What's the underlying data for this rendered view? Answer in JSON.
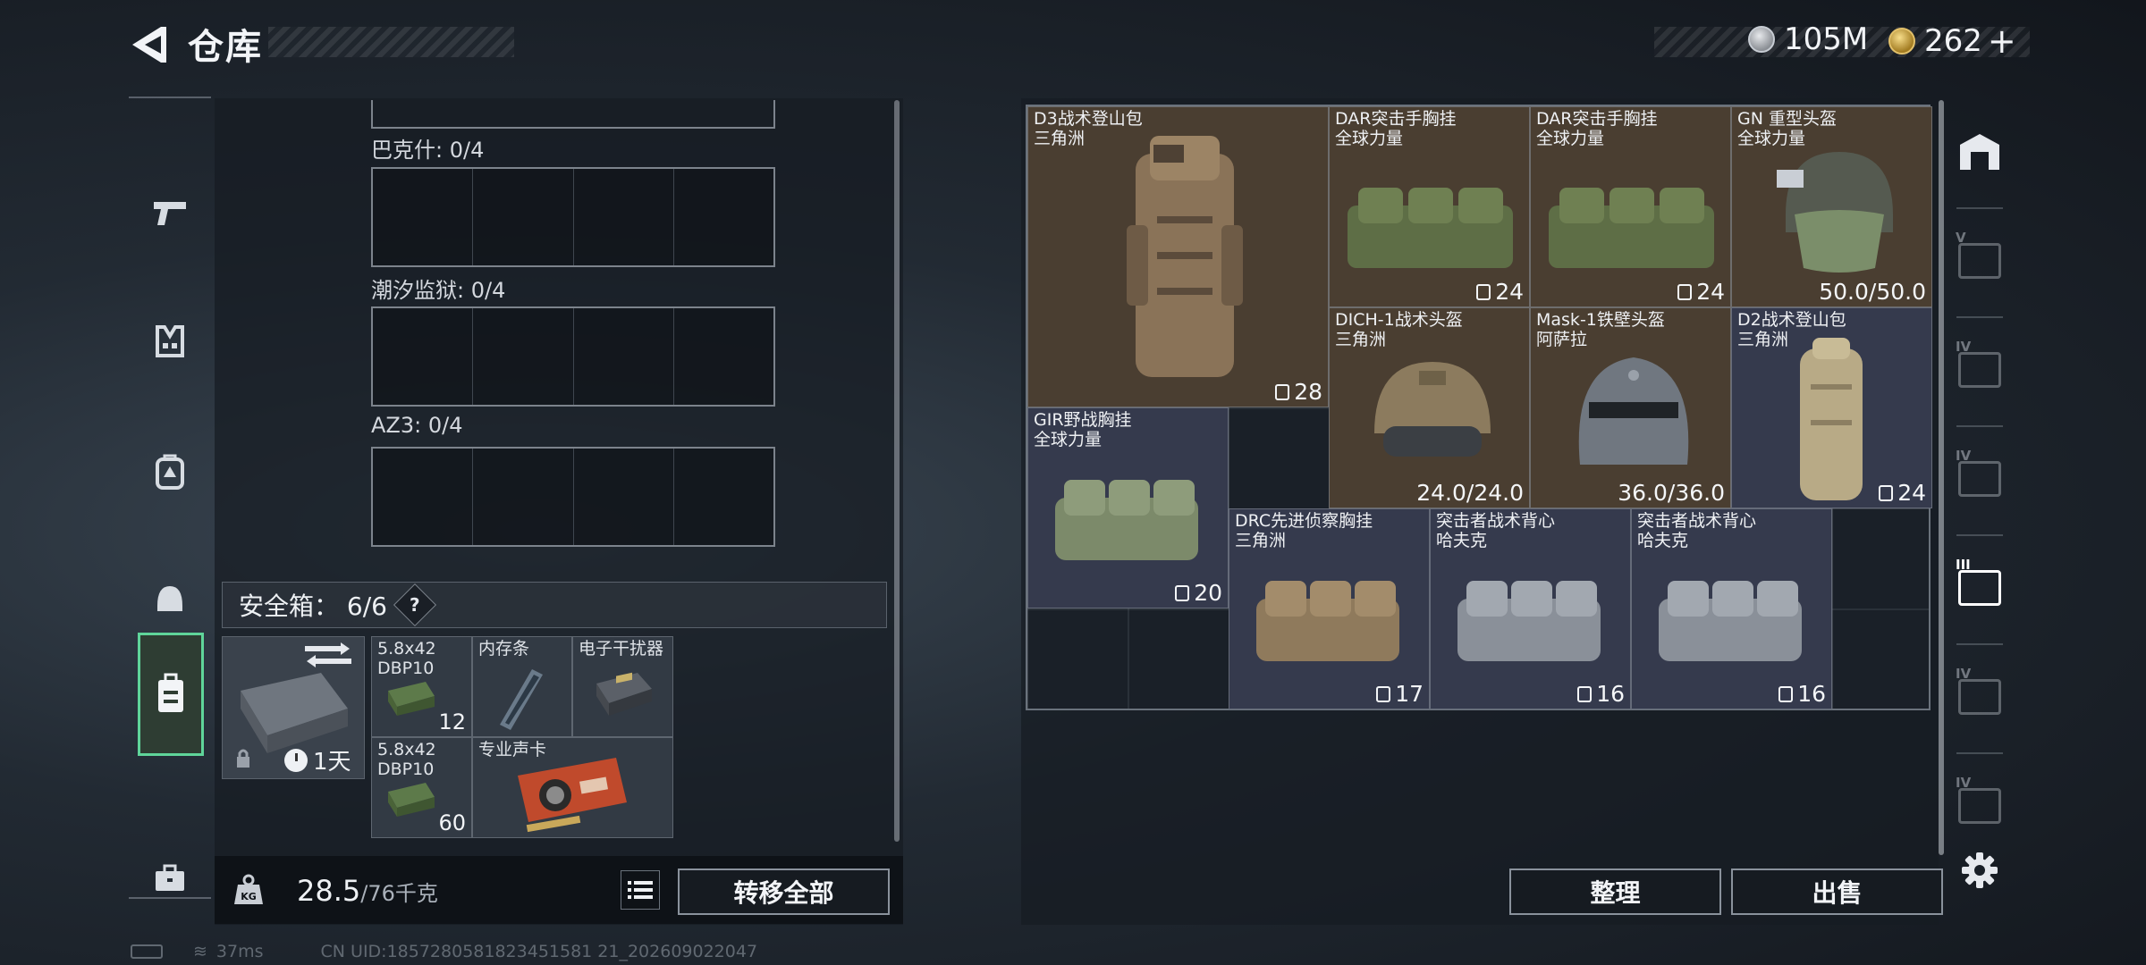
{
  "header": {
    "title": "仓库",
    "currency_silver": "105M",
    "currency_gold": "262"
  },
  "left_tabs": [
    {
      "icon": "pistol-icon"
    },
    {
      "icon": "vest-icon"
    },
    {
      "icon": "backpack-icon"
    },
    {
      "icon": "helmet-icon"
    },
    {
      "icon": "safe-case-icon",
      "active": true
    },
    {
      "icon": "briefcase-icon"
    }
  ],
  "slots": [
    {
      "label": "巴克什: 0/4"
    },
    {
      "label": "潮汐监狱: 0/4"
    },
    {
      "label": "AZ3: 0/4"
    }
  ],
  "safe": {
    "label": "安全箱： 6/6",
    "help": "?",
    "time": "1天",
    "items": [
      {
        "name_line1": "5.8x42",
        "name_line2": "DBP10",
        "count": "12"
      },
      {
        "name_line1": "内存条",
        "name_line2": "",
        "count": ""
      },
      {
        "name_line1": "电子干扰器",
        "name_line2": "",
        "count": ""
      },
      {
        "name_line1": "5.8x42",
        "name_line2": "DBP10",
        "count": "60"
      },
      {
        "name_line1": "专业声卡",
        "name_line2": "",
        "count": ""
      }
    ]
  },
  "bottom": {
    "weight_value": "28.5",
    "weight_unit": "/76千克",
    "transfer_all": "转移全部"
  },
  "grid_items": [
    {
      "name_line1": "D3战术登山包",
      "name_line2": "三角洲",
      "count": "28",
      "count_icon": "backpack-mini-icon",
      "tone": "brown"
    },
    {
      "name_line1": "DAR突击手胸挂",
      "name_line2": "全球力量",
      "count": "24",
      "count_icon": "vest-mini-icon",
      "tone": "brown"
    },
    {
      "name_line1": "DAR突击手胸挂",
      "name_line2": "全球力量",
      "count": "24",
      "count_icon": "vest-mini-icon",
      "tone": "brown"
    },
    {
      "name_line1": "GN 重型头盔",
      "name_line2": "全球力量",
      "count": "50.0/50.0",
      "count_icon": "",
      "tone": "brown"
    },
    {
      "name_line1": "DICH-1战术头盔",
      "name_line2": "三角洲",
      "count": "24.0/24.0",
      "count_icon": "",
      "tone": "brown"
    },
    {
      "name_line1": "Mask-1铁壁头盔",
      "name_line2": "阿萨拉",
      "count": "36.0/36.0",
      "count_icon": "",
      "tone": "brown"
    },
    {
      "name_line1": "D2战术登山包",
      "name_line2": "三角洲",
      "count": "24",
      "count_icon": "backpack-mini-icon",
      "tone": "blue"
    },
    {
      "name_line1": "GIR野战胸挂",
      "name_line2": "全球力量",
      "count": "20",
      "count_icon": "vest-mini-icon",
      "tone": "blue"
    },
    {
      "name_line1": "DRC先进侦察胸挂",
      "name_line2": "三角洲",
      "count": "17",
      "count_icon": "vest-mini-icon",
      "tone": "blue"
    },
    {
      "name_line1": "突击者战术背心",
      "name_line2": "哈夫克",
      "count": "16",
      "count_icon": "vest-mini-icon",
      "tone": "blue"
    },
    {
      "name_line1": "突击者战术背心",
      "name_line2": "哈夫克",
      "count": "16",
      "count_icon": "vest-mini-icon",
      "tone": "blue"
    }
  ],
  "right_actions": {
    "sort": "整理",
    "sell": "出售"
  },
  "right_tabs": [
    {
      "icon": "warehouse-icon",
      "level": ""
    },
    {
      "icon": "storage-v-icon",
      "level": "V"
    },
    {
      "icon": "storage-iv-icon",
      "level": "IV"
    },
    {
      "icon": "storage-iv-add-icon",
      "level": "IV"
    },
    {
      "icon": "storage-iii-icon",
      "level": "III",
      "active": true
    },
    {
      "icon": "storage-iv-b-icon",
      "level": "IV"
    },
    {
      "icon": "storage-iv-add-b-icon",
      "level": "IV"
    }
  ],
  "status_bar": {
    "ping": "37ms",
    "uid": "CN UID:1857280581823451581 21_202609022047"
  },
  "colors": {
    "accent_active": "#5fd59a",
    "brown_slot": "#4a3e31",
    "blue_slot": "#353a4d"
  }
}
